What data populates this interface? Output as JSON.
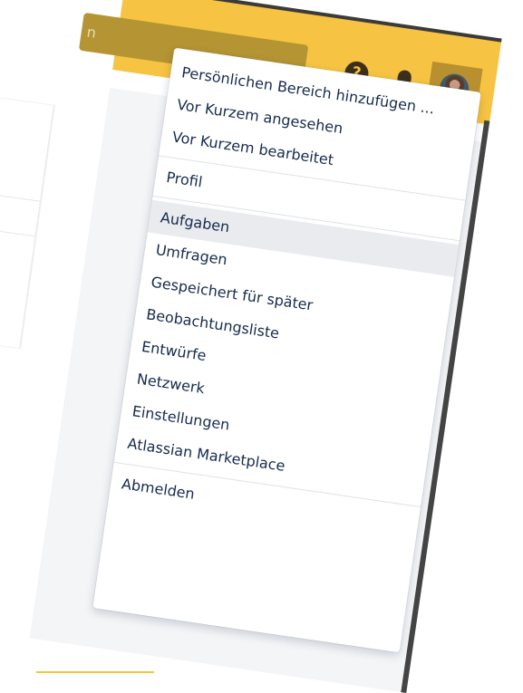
{
  "topbar": {
    "search_placeholder_fragment": "n",
    "help_label": "?"
  },
  "menu": {
    "section1": [
      {
        "label": "Persönlichen Bereich hinzufügen ...",
        "name": "menu-item-add-personal-space"
      },
      {
        "label": "Vor Kurzem angesehen",
        "name": "menu-item-recently-viewed"
      },
      {
        "label": "Vor Kurzem bearbeitet",
        "name": "menu-item-recently-worked-on"
      }
    ],
    "section2": [
      {
        "label": "Profil",
        "name": "menu-item-profile"
      }
    ],
    "section3": [
      {
        "label": "Aufgaben",
        "name": "menu-item-tasks",
        "hovered": true
      },
      {
        "label": "Umfragen",
        "name": "menu-item-surveys"
      },
      {
        "label": "Gespeichert für später",
        "name": "menu-item-saved-for-later"
      },
      {
        "label": "Beobachtungsliste",
        "name": "menu-item-watches"
      },
      {
        "label": "Entwürfe",
        "name": "menu-item-drafts"
      },
      {
        "label": "Netzwerk",
        "name": "menu-item-network"
      },
      {
        "label": "Einstellungen",
        "name": "menu-item-settings"
      },
      {
        "label": "Atlassian Marketplace",
        "name": "menu-item-atlassian-marketplace"
      }
    ],
    "section4": [
      {
        "label": "Abmelden",
        "name": "menu-item-logout"
      }
    ]
  },
  "colors": {
    "topbar": "#f6c342",
    "search_bg": "#b49433",
    "menu_text": "#172b4d",
    "hover_bg": "#e9ebef"
  },
  "icons": [
    "help-icon",
    "bell-icon",
    "avatar"
  ]
}
